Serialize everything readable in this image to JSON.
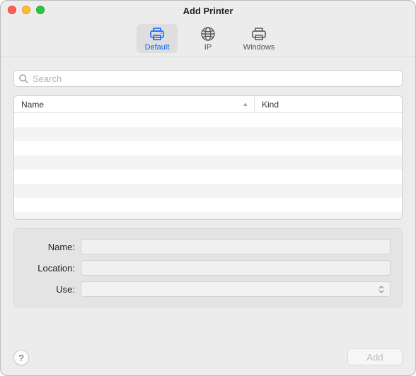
{
  "window": {
    "title": "Add Printer"
  },
  "toolbar": {
    "tabs": [
      {
        "label": "Default",
        "selected": true
      },
      {
        "label": "IP",
        "selected": false
      },
      {
        "label": "Windows",
        "selected": false
      }
    ]
  },
  "search": {
    "placeholder": "Search",
    "value": ""
  },
  "list": {
    "columns": {
      "name": "Name",
      "kind": "Kind"
    },
    "sort_indicator": "▴",
    "rows": []
  },
  "form": {
    "name": {
      "label": "Name:",
      "value": ""
    },
    "location": {
      "label": "Location:",
      "value": ""
    },
    "use": {
      "label": "Use:",
      "value": ""
    }
  },
  "footer": {
    "help": "?",
    "add": "Add",
    "add_enabled": false
  }
}
